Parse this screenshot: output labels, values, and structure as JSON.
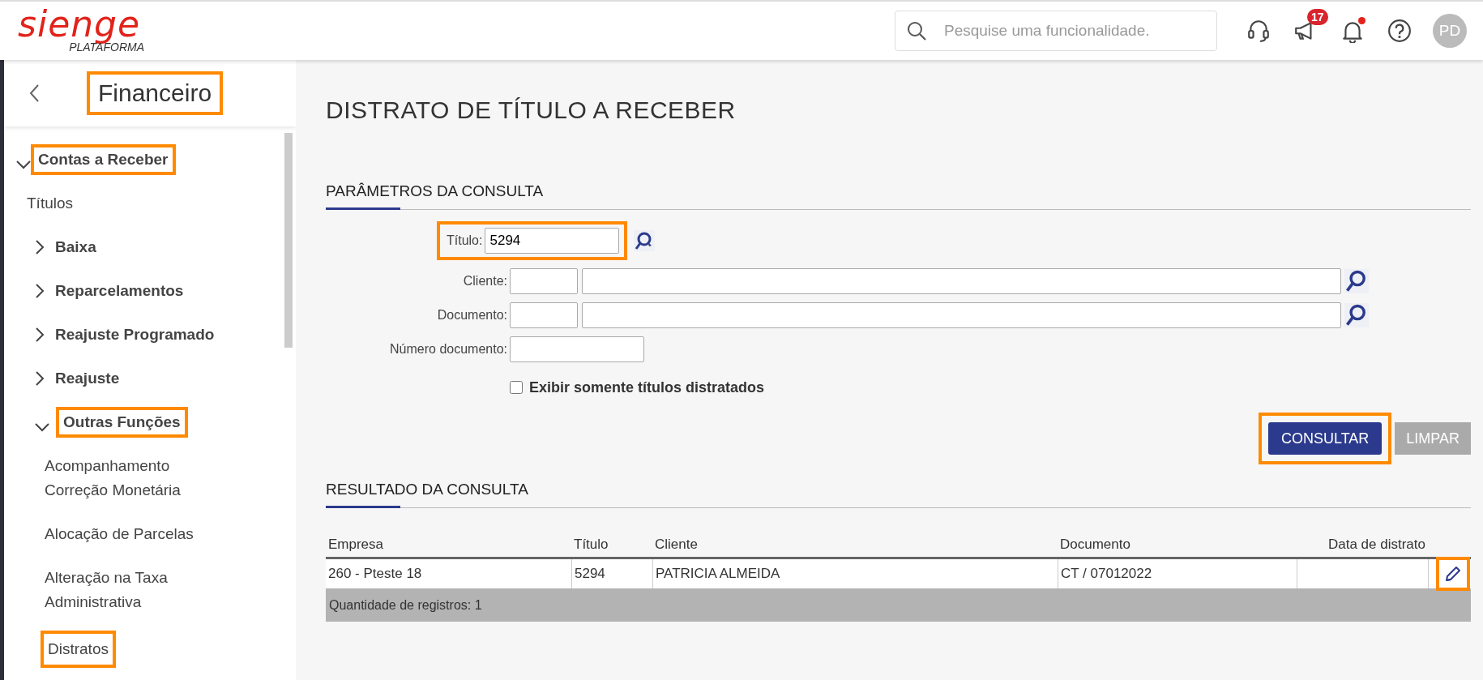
{
  "header": {
    "logo": {
      "wordmark": "sienge",
      "tagline": "PLATAFORMA"
    },
    "search": {
      "placeholder": "Pesquise uma funcionalidade."
    },
    "icons": [
      {
        "kind": "headset"
      },
      {
        "kind": "megaphone",
        "badge": "17"
      },
      {
        "kind": "bell",
        "dot": true
      },
      {
        "kind": "help"
      }
    ],
    "avatar": "PD"
  },
  "sidebar": {
    "title": "Financeiro",
    "title_highlighted": true,
    "items": [
      {
        "label": "Contas a Receber",
        "kind": "group",
        "expanded": true,
        "highlighted": true,
        "children": [
          {
            "label": "Títulos",
            "kind": "link",
            "highlighted": false
          },
          {
            "label": "Baixa",
            "kind": "group",
            "expanded": false,
            "highlighted": false
          },
          {
            "label": "Reparcelamentos",
            "kind": "group",
            "expanded": false,
            "highlighted": false
          },
          {
            "label": "Reajuste Programado",
            "kind": "group",
            "expanded": false,
            "highlighted": false
          },
          {
            "label": "Reajuste",
            "kind": "group",
            "expanded": false,
            "highlighted": false
          },
          {
            "label": "Outras Funções",
            "kind": "group",
            "expanded": true,
            "highlighted": true,
            "children": [
              {
                "label": "Acompanhamento Correção Monetária",
                "kind": "link",
                "highlighted": false
              },
              {
                "label": "Alocação de Parcelas",
                "kind": "link",
                "highlighted": false
              },
              {
                "label": "Alteração na Taxa Administrativa",
                "kind": "link",
                "highlighted": false
              },
              {
                "label": "Distratos",
                "kind": "link",
                "highlighted": true
              }
            ]
          }
        ]
      }
    ]
  },
  "page": {
    "title": "DISTRATO DE TÍTULO A RECEBER",
    "parameters": {
      "title": "PARÂMETROS DA CONSULTA",
      "fields": [
        {
          "label": "Título:",
          "kind": "code",
          "value": "5294",
          "highlighted": true
        },
        {
          "label": "Cliente:",
          "kind": "lookup",
          "highlighted": false
        },
        {
          "label": "Documento:",
          "kind": "lookup",
          "highlighted": false
        },
        {
          "label": "Número documento:",
          "kind": "text",
          "highlighted": false
        }
      ],
      "checkbox": {
        "label": "Exibir somente títulos distratados",
        "checked": false
      },
      "buttons": [
        {
          "label": "CONSULTAR",
          "kind": "primary",
          "highlighted": true
        },
        {
          "label": "LIMPAR",
          "kind": "secondary",
          "highlighted": false
        }
      ]
    },
    "results": {
      "title": "RESULTADO DA CONSULTA",
      "table": {
        "columns": [
          "Empresa",
          "Título",
          "Cliente",
          "Documento",
          "Data de distrato"
        ],
        "rows": [
          {
            "cells": [
              "260 - Pteste 18",
              "5294",
              "PATRICIA ALMEIDA",
              "CT / 07012022"
            ],
            "editable": true,
            "action_highlighted": true
          }
        ],
        "footer": "Quantidade de registros: 1"
      }
    }
  }
}
